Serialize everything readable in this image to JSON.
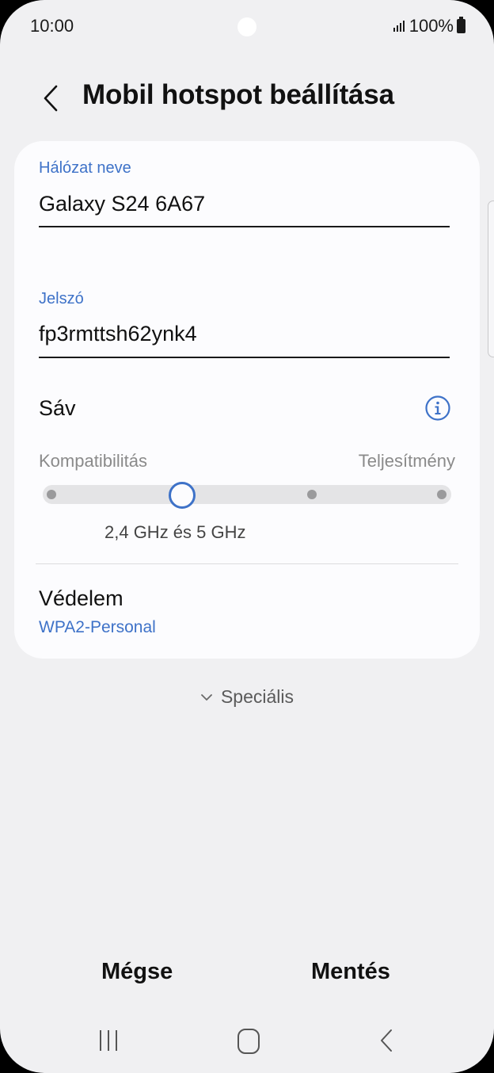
{
  "status_bar": {
    "time": "10:00",
    "battery": "100%"
  },
  "header": {
    "title": "Mobil hotspot beállítása"
  },
  "network": {
    "label": "Hálózat neve",
    "value": "Galaxy S24 6A67"
  },
  "password": {
    "label": "Jelszó",
    "value": "fp3rmttsh62ynk4"
  },
  "band": {
    "title": "Sáv",
    "left_label": "Kompatibilitás",
    "right_label": "Teljesítmény",
    "selected_label": "2,4 GHz és 5 GHz",
    "steps": 4,
    "selected_index": 1
  },
  "security": {
    "title": "Védelem",
    "value": "WPA2-Personal"
  },
  "advanced": {
    "label": "Speciális"
  },
  "actions": {
    "cancel": "Mégse",
    "save": "Mentés"
  },
  "colors": {
    "accent": "#3e72c8",
    "background": "#f0f0f2",
    "card": "#fcfcfe"
  }
}
